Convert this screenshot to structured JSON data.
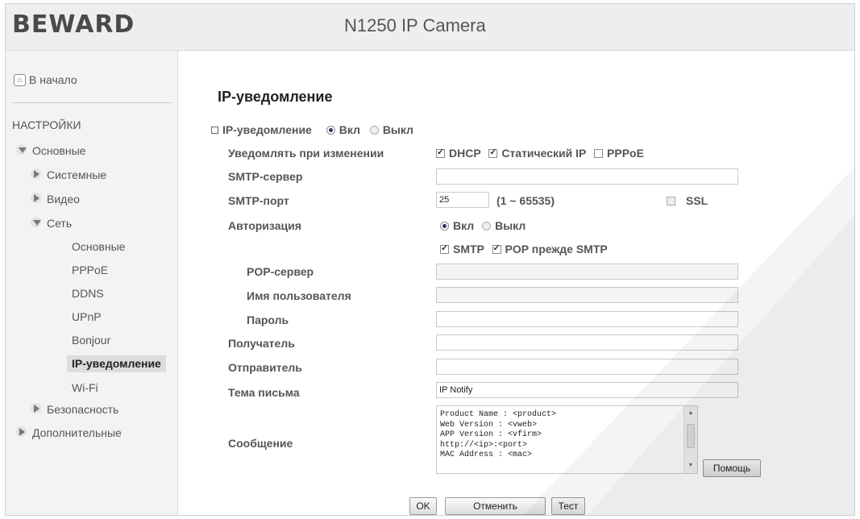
{
  "header": {
    "logo": "BEWARD",
    "camera_title": "N1250 IP Camera"
  },
  "sidebar": {
    "home": "В начало",
    "settings_title": "НАСТРОЙКИ",
    "basic": "Основные",
    "system": "Системные",
    "video": "Видео",
    "network": "Сеть",
    "net_items": [
      "Основные",
      "PPPoE",
      "DDNS",
      "UPnP",
      "Bonjour",
      "IP-уведомление",
      "Wi-Fi"
    ],
    "security": "Безопасность",
    "advanced": "Дополнительные"
  },
  "main": {
    "title": "IP-уведомление",
    "ip_notify_label": "IP-уведомление",
    "on": "Вкл",
    "off": "Выкл",
    "notify_on_change": "Уведомлять при изменении",
    "dhcp": "DHCP",
    "static_ip": "Статический IP",
    "pppoe": "PPPoE",
    "smtp_server": "SMTP-сервер",
    "smtp_port": "SMTP-порт",
    "smtp_port_value": "25",
    "port_range": "(1 ~ 65535)",
    "ssl": "SSL",
    "auth": "Авторизация",
    "smtp": "SMTP",
    "pop_before_smtp": "POP прежде SMTP",
    "pop_server": "POP-сервер",
    "username": "Имя пользователя",
    "password": "Пароль",
    "recipient": "Получатель",
    "sender": "Отправитель",
    "subject": "Тема письма",
    "subject_value": "IP Notify",
    "message": "Сообщение",
    "message_value": "Product Name : <product>\nWeb Version : <vweb>\nAPP Version : <vfirm>\nhttp://<ip>:<port>\nMAC Address : <mac>",
    "help": "Помощь",
    "ok": "OK",
    "cancel": "Отменить",
    "test": "Тест"
  }
}
